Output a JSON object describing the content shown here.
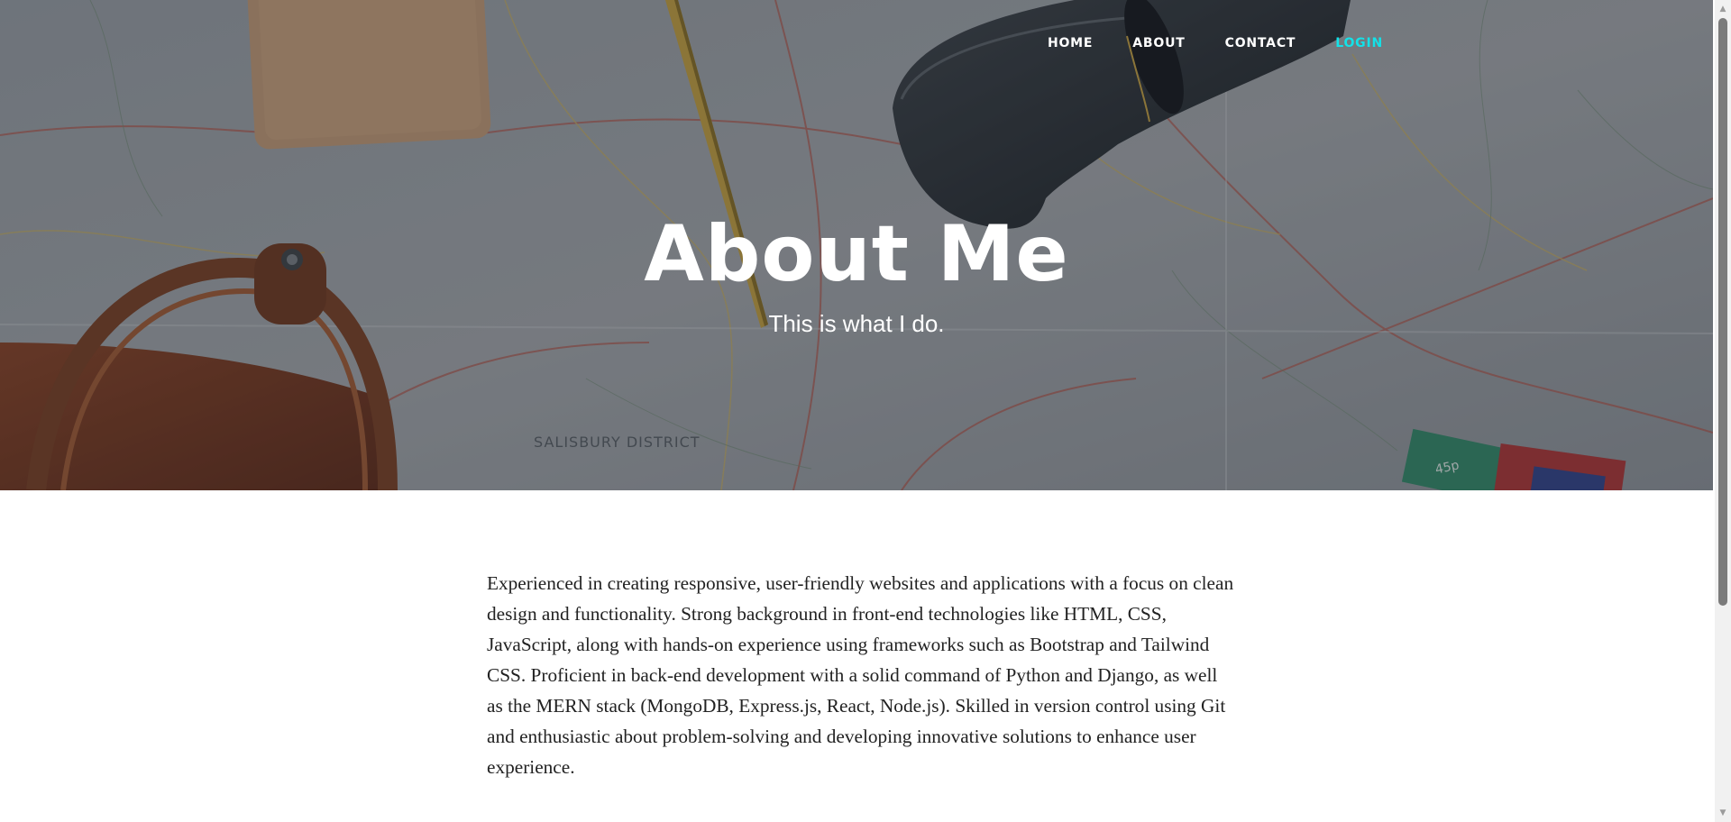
{
  "nav": {
    "items": [
      {
        "label": "HOME"
      },
      {
        "label": "ABOUT"
      },
      {
        "label": "CONTACT"
      },
      {
        "label": "LOGIN",
        "active": true
      }
    ],
    "active_color": "#13e2e8"
  },
  "hero": {
    "title": "About Me",
    "subtitle": "This is what I do.",
    "map_label": "SALISBURY DISTRICT",
    "stamp_label": "45p"
  },
  "about": {
    "paragraph": "Experienced in creating responsive, user-friendly websites and applications with a focus on clean design and functionality. Strong background in front-end technologies like HTML, CSS, JavaScript, along with hands-on experience using frameworks such as Bootstrap and Tailwind CSS. Proficient in back-end development with a solid command of Python and Django, as well as the MERN stack (MongoDB, Express.js, React, Node.js). Skilled in version control using Git and enthusiastic about problem-solving and developing innovative solutions to enhance user experience."
  },
  "scrollbar": {
    "up_icon": "scroll-up-arrow-icon",
    "down_icon": "scroll-down-arrow-icon"
  }
}
